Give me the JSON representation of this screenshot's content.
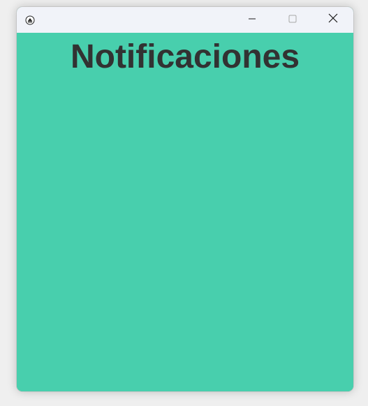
{
  "window": {
    "controls": {
      "minimize_icon": "minimize-icon",
      "maximize_icon": "maximize-icon",
      "close_icon": "close-icon"
    }
  },
  "main": {
    "heading": "Notificaciones"
  },
  "colors": {
    "content_background": "#48cfad",
    "titlebar_background": "#f1f3f9",
    "heading_text": "#323232"
  }
}
